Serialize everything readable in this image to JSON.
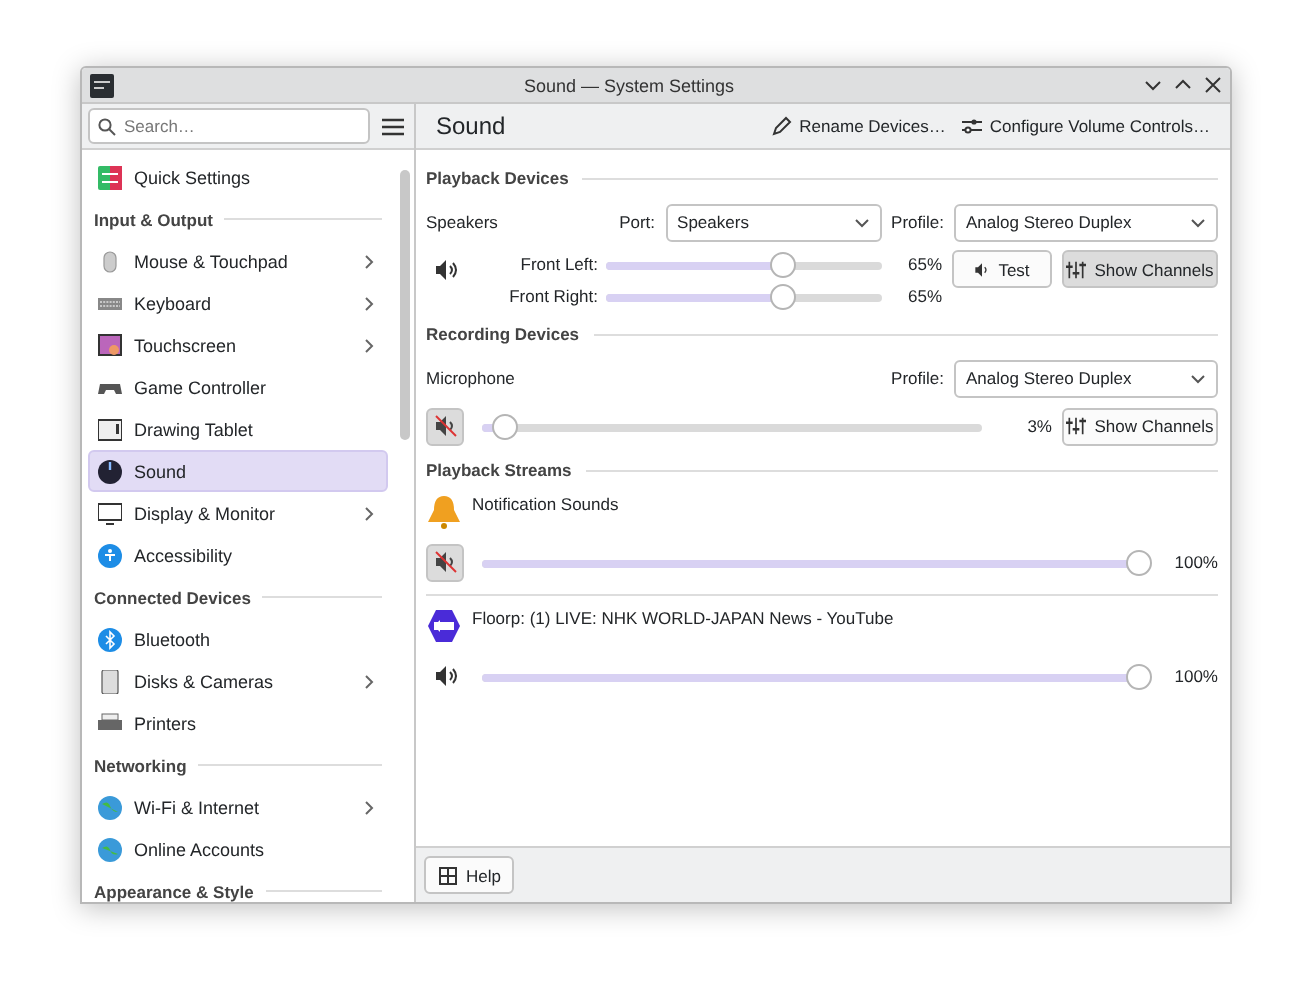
{
  "window": {
    "title": "Sound — System Settings"
  },
  "sidebar": {
    "search": {
      "placeholder": "Search…"
    },
    "sections": [
      {
        "items": [
          {
            "label": "Quick Settings",
            "selected": false,
            "has_children": false
          }
        ]
      },
      {
        "header": "Input & Output",
        "items": [
          {
            "label": "Mouse & Touchpad",
            "selected": false,
            "has_children": true
          },
          {
            "label": "Keyboard",
            "selected": false,
            "has_children": true
          },
          {
            "label": "Touchscreen",
            "selected": false,
            "has_children": true
          },
          {
            "label": "Game Controller",
            "selected": false,
            "has_children": false
          },
          {
            "label": "Drawing Tablet",
            "selected": false,
            "has_children": false
          },
          {
            "label": "Sound",
            "selected": true,
            "has_children": false
          },
          {
            "label": "Display & Monitor",
            "selected": false,
            "has_children": true
          },
          {
            "label": "Accessibility",
            "selected": false,
            "has_children": false
          }
        ]
      },
      {
        "header": "Connected Devices",
        "items": [
          {
            "label": "Bluetooth",
            "selected": false,
            "has_children": false
          },
          {
            "label": "Disks & Cameras",
            "selected": false,
            "has_children": true
          },
          {
            "label": "Printers",
            "selected": false,
            "has_children": false
          }
        ]
      },
      {
        "header": "Networking",
        "items": [
          {
            "label": "Wi-Fi & Internet",
            "selected": false,
            "has_children": true
          },
          {
            "label": "Online Accounts",
            "selected": false,
            "has_children": false
          }
        ]
      },
      {
        "header": "Appearance & Style"
      }
    ]
  },
  "page": {
    "title": "Sound",
    "actions": [
      {
        "label": "Rename Devices…"
      },
      {
        "label": "Configure Volume Controls…"
      }
    ]
  },
  "playback_devices": {
    "heading": "Playback Devices",
    "devices": [
      {
        "name": "Speakers",
        "port_label": "Port:",
        "port": "Speakers",
        "profile_label": "Profile:",
        "profile": "Analog Stereo Duplex",
        "muted": false,
        "channels": [
          {
            "label": "Front Left:",
            "level": 0.65,
            "reading": "65%"
          },
          {
            "label": "Front Right:",
            "level": 0.65,
            "reading": "65%"
          }
        ],
        "test_button": "Test",
        "show_channels": {
          "label": "Show Channels",
          "checked": true
        }
      }
    ]
  },
  "recording_devices": {
    "heading": "Recording Devices",
    "devices": [
      {
        "name": "Microphone",
        "profile_label": "Profile:",
        "profile": "Analog Stereo Duplex",
        "muted": true,
        "level": 0.03,
        "reading": "3%",
        "show_channels": {
          "label": "Show Channels",
          "checked": false
        }
      }
    ]
  },
  "playback_streams": {
    "heading": "Playback Streams",
    "streams": [
      {
        "name": "Notification Sounds",
        "muted": true,
        "level": 1,
        "reading": "100%"
      },
      {
        "name": "Floorp: (1) LIVE: NHK WORLD-JAPAN News - YouTube",
        "muted": false,
        "level": 1,
        "reading": "100%"
      }
    ]
  },
  "footer": {
    "help": "Help"
  }
}
